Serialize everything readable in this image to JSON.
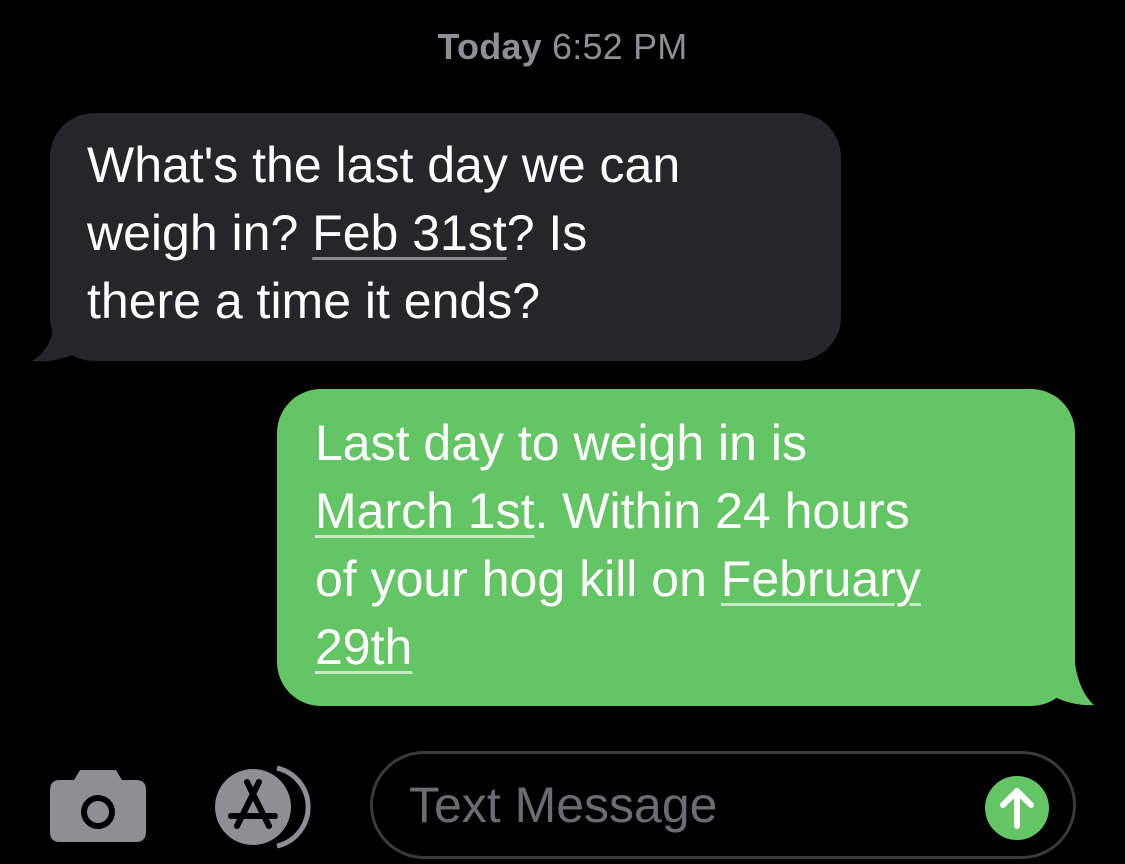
{
  "header": {
    "day": "Today",
    "time": "6:52 PM"
  },
  "messages": [
    {
      "direction": "incoming",
      "bubble_color": "#26252a",
      "lines": [
        [
          {
            "text": "What's the last day we can",
            "link": false
          }
        ],
        [
          {
            "text": "weigh in? ",
            "link": false
          },
          {
            "text": "Feb 31st",
            "link": true
          },
          {
            "text": "? Is",
            "link": false
          }
        ],
        [
          {
            "text": "there a time it ends?",
            "link": false
          }
        ]
      ]
    },
    {
      "direction": "outgoing",
      "bubble_color": "#65c466",
      "lines": [
        [
          {
            "text": "Last day to weigh in is",
            "link": false
          }
        ],
        [
          {
            "text": "March 1st",
            "link": true
          },
          {
            "text": ". Within 24 hours",
            "link": false
          }
        ],
        [
          {
            "text": "of your hog kill on ",
            "link": false
          },
          {
            "text": "February",
            "link": true
          }
        ],
        [
          {
            "text": "29th",
            "link": true
          }
        ]
      ]
    }
  ],
  "composer": {
    "placeholder": "Text Message",
    "value": "",
    "camera_icon": "camera-icon",
    "apps_icon": "app-store-icon",
    "send_icon": "arrow-up-icon"
  },
  "colors": {
    "background": "#000000",
    "incoming_bubble": "#26252a",
    "outgoing_bubble": "#65c466",
    "timestamp": "#8e8e93",
    "icon_gray": "#8e8e93"
  }
}
